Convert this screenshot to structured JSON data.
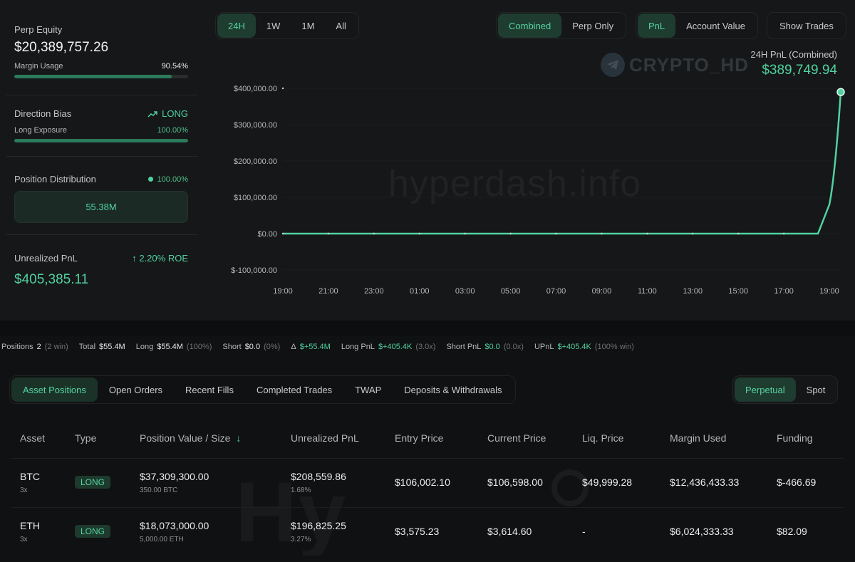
{
  "sidebar": {
    "perp_equity_label": "Perp Equity",
    "perp_equity_value": "$20,389,757.26",
    "margin_usage_label": "Margin Usage",
    "margin_usage_value": "90.54%",
    "margin_usage_fraction": 0.9054,
    "direction_bias_label": "Direction Bias",
    "direction_bias_value": "LONG",
    "long_exposure_label": "Long Exposure",
    "long_exposure_value": "100.00%",
    "long_exposure_fraction": 1.0,
    "position_distribution_label": "Position Distribution",
    "position_distribution_pct": "100.00%",
    "position_distribution_value": "55.38M",
    "unrealized_pnl_label": "Unrealized PnL",
    "unrealized_roe": "2.20% ROE",
    "unrealized_pnl_value": "$405,385.11"
  },
  "timeframes": [
    "24H",
    "1W",
    "1M",
    "All"
  ],
  "timeframe_active": "24H",
  "mode_toggle": [
    "Combined",
    "Perp Only"
  ],
  "mode_active": "Combined",
  "metric_toggle": [
    "PnL",
    "Account Value"
  ],
  "metric_active": "PnL",
  "show_trades_label": "Show Trades",
  "chart_header": {
    "title": "24H PnL (Combined)",
    "value": "$389,749.94"
  },
  "watermarks": {
    "telegram": "CRYPTO_HD",
    "site": "hyperdash.info"
  },
  "chart_data": {
    "type": "line",
    "title": "24H PnL (Combined)",
    "xlabel": "",
    "ylabel": "",
    "x_ticks": [
      "19:00",
      "21:00",
      "23:00",
      "01:00",
      "03:00",
      "05:00",
      "07:00",
      "09:00",
      "11:00",
      "13:00",
      "15:00",
      "17:00",
      "19:00"
    ],
    "y_ticks": [
      "$400,000.00",
      "$300,000.00",
      "$200,000.00",
      "$100,000.00",
      "$0.00",
      "$-100,000.00"
    ],
    "ylim": [
      -100000,
      400000
    ],
    "x_hours": [
      0,
      2,
      4,
      6,
      8,
      10,
      12,
      14,
      16,
      18,
      20,
      22,
      23.5,
      24.0,
      24.5
    ],
    "values": [
      0,
      0,
      0,
      0,
      0,
      0,
      0,
      0,
      0,
      0,
      0,
      0,
      0,
      80000,
      389749.94
    ],
    "color": "#50d2a0",
    "grid": true
  },
  "summary": {
    "positions_label": "Positions",
    "positions_value": "2",
    "positions_win": "(2 win)",
    "total_label": "Total",
    "total_value": "$55.4M",
    "long_label": "Long",
    "long_value": "$55.4M",
    "long_pct": "(100%)",
    "short_label": "Short",
    "short_value": "$0.0",
    "short_pct": "(0%)",
    "delta_label": "Δ",
    "delta_value": "$+55.4M",
    "long_pnl_label": "Long PnL",
    "long_pnl_value": "$+405.4K",
    "long_pnl_x": "(3.0x)",
    "short_pnl_label": "Short PnL",
    "short_pnl_value": "$0.0",
    "short_pnl_x": "(0.0x)",
    "upnl_label": "UPnL",
    "upnl_value": "$+405.4K",
    "upnl_win": "(100% win)"
  },
  "tabs": [
    "Asset Positions",
    "Open Orders",
    "Recent Fills",
    "Completed Trades",
    "TWAP",
    "Deposits & Withdrawals"
  ],
  "tab_active": "Asset Positions",
  "market_toggle": [
    "Perpetual",
    "Spot"
  ],
  "market_active": "Perpetual",
  "table": {
    "headers": [
      "Asset",
      "Type",
      "Position Value / Size",
      "Unrealized PnL",
      "Entry Price",
      "Current Price",
      "Liq. Price",
      "Margin Used",
      "Funding"
    ],
    "rows": [
      {
        "asset": "BTC",
        "leverage": "3x",
        "type": "LONG",
        "position_value": "$37,309,300.00",
        "size": "350.00 BTC",
        "upnl": "$208,559.86",
        "upnl_pct": "1.68%",
        "entry": "$106,002.10",
        "current": "$106,598.00",
        "liq": "$49,999.28",
        "margin": "$12,436,433.33",
        "funding": "$-466.69",
        "funding_color": "#e8675e"
      },
      {
        "asset": "ETH",
        "leverage": "3x",
        "type": "LONG",
        "position_value": "$18,073,000.00",
        "size": "5,000.00 ETH",
        "upnl": "$196,825.25",
        "upnl_pct": "3.27%",
        "entry": "$3,575.23",
        "current": "$3,614.60",
        "liq": "-",
        "margin": "$6,024,333.33",
        "funding": "$82.09",
        "funding_color": "#50d2a0"
      }
    ]
  }
}
